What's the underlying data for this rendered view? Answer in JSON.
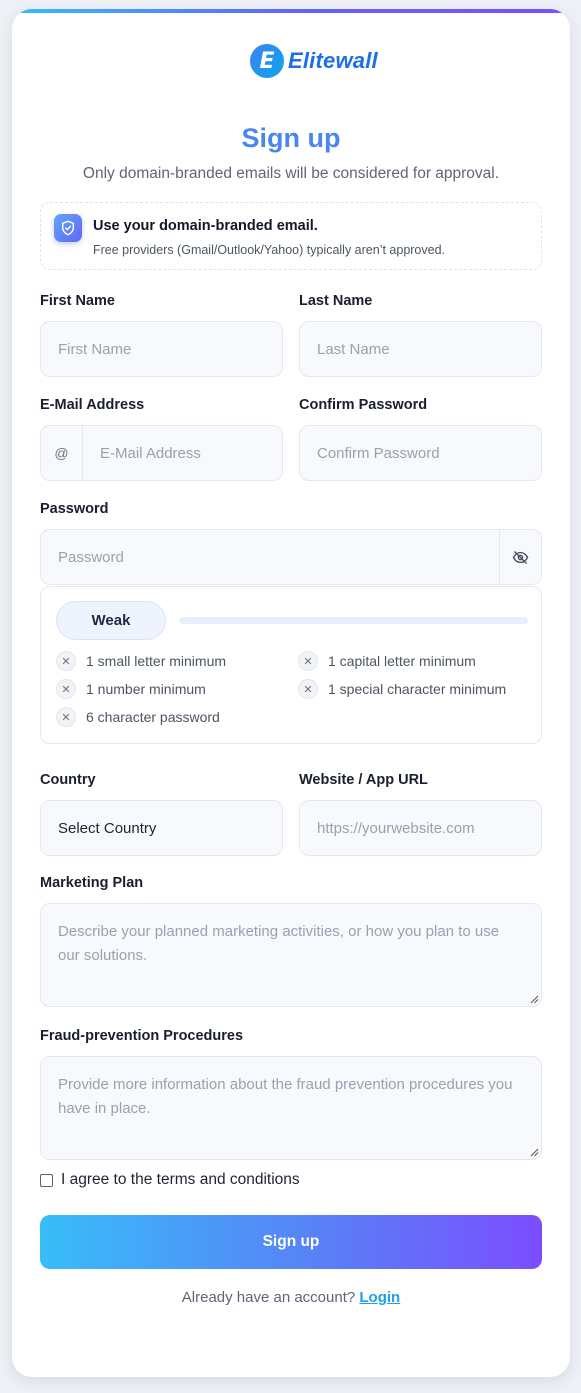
{
  "brand": {
    "name": "Elitewall",
    "logo_letter": "E"
  },
  "header": {
    "title": "Sign up",
    "subtitle": "Only domain-branded emails will be considered for approval."
  },
  "notice": {
    "title": "Use your domain-branded email.",
    "text": "Free providers (Gmail/Outlook/Yahoo) typically aren’t approved."
  },
  "fields": {
    "first_name": {
      "label": "First Name",
      "placeholder": "First Name"
    },
    "last_name": {
      "label": "Last Name",
      "placeholder": "Last Name"
    },
    "email": {
      "label": "E-Mail Address",
      "placeholder": "E-Mail Address",
      "addon": "@"
    },
    "confirm_password": {
      "label": "Confirm Password",
      "placeholder": "Confirm Password"
    },
    "password": {
      "label": "Password",
      "placeholder": "Password"
    },
    "country": {
      "label": "Country",
      "value": "Select Country"
    },
    "website": {
      "label": "Website / App URL",
      "placeholder": "https://yourwebsite.com"
    },
    "marketing_plan": {
      "label": "Marketing Plan",
      "placeholder": "Describe your planned marketing activities, or how you plan to use our solutions."
    },
    "fraud_prevention": {
      "label": "Fraud-prevention Procedures",
      "placeholder": "Provide more information about the fraud prevention procedures you have in place."
    }
  },
  "password_strength": {
    "level": "Weak",
    "fill_fraction": 0,
    "requirements": [
      {
        "text": "1 small letter minimum",
        "met": false
      },
      {
        "text": "1 capital letter minimum",
        "met": false
      },
      {
        "text": "1 number minimum",
        "met": false
      },
      {
        "text": "1 special character minimum",
        "met": false
      },
      {
        "text": "6 character password",
        "met": false
      }
    ],
    "unmet_icon": "close-icon"
  },
  "agree": {
    "label": "I agree to the terms and conditions",
    "checked": false
  },
  "actions": {
    "signup_label": "Sign up"
  },
  "footer": {
    "prompt": "Already have an account?",
    "login_label": "Login"
  },
  "colors": {
    "title": "#4a86ee",
    "accent_gradient_start": "#38bdf8",
    "accent_gradient_end": "#7c4dff",
    "link": "#1ea0e8"
  },
  "icons": {
    "notice": "shield-check-icon",
    "password_toggle": "eye-off-icon",
    "email_addon": "at-icon"
  }
}
